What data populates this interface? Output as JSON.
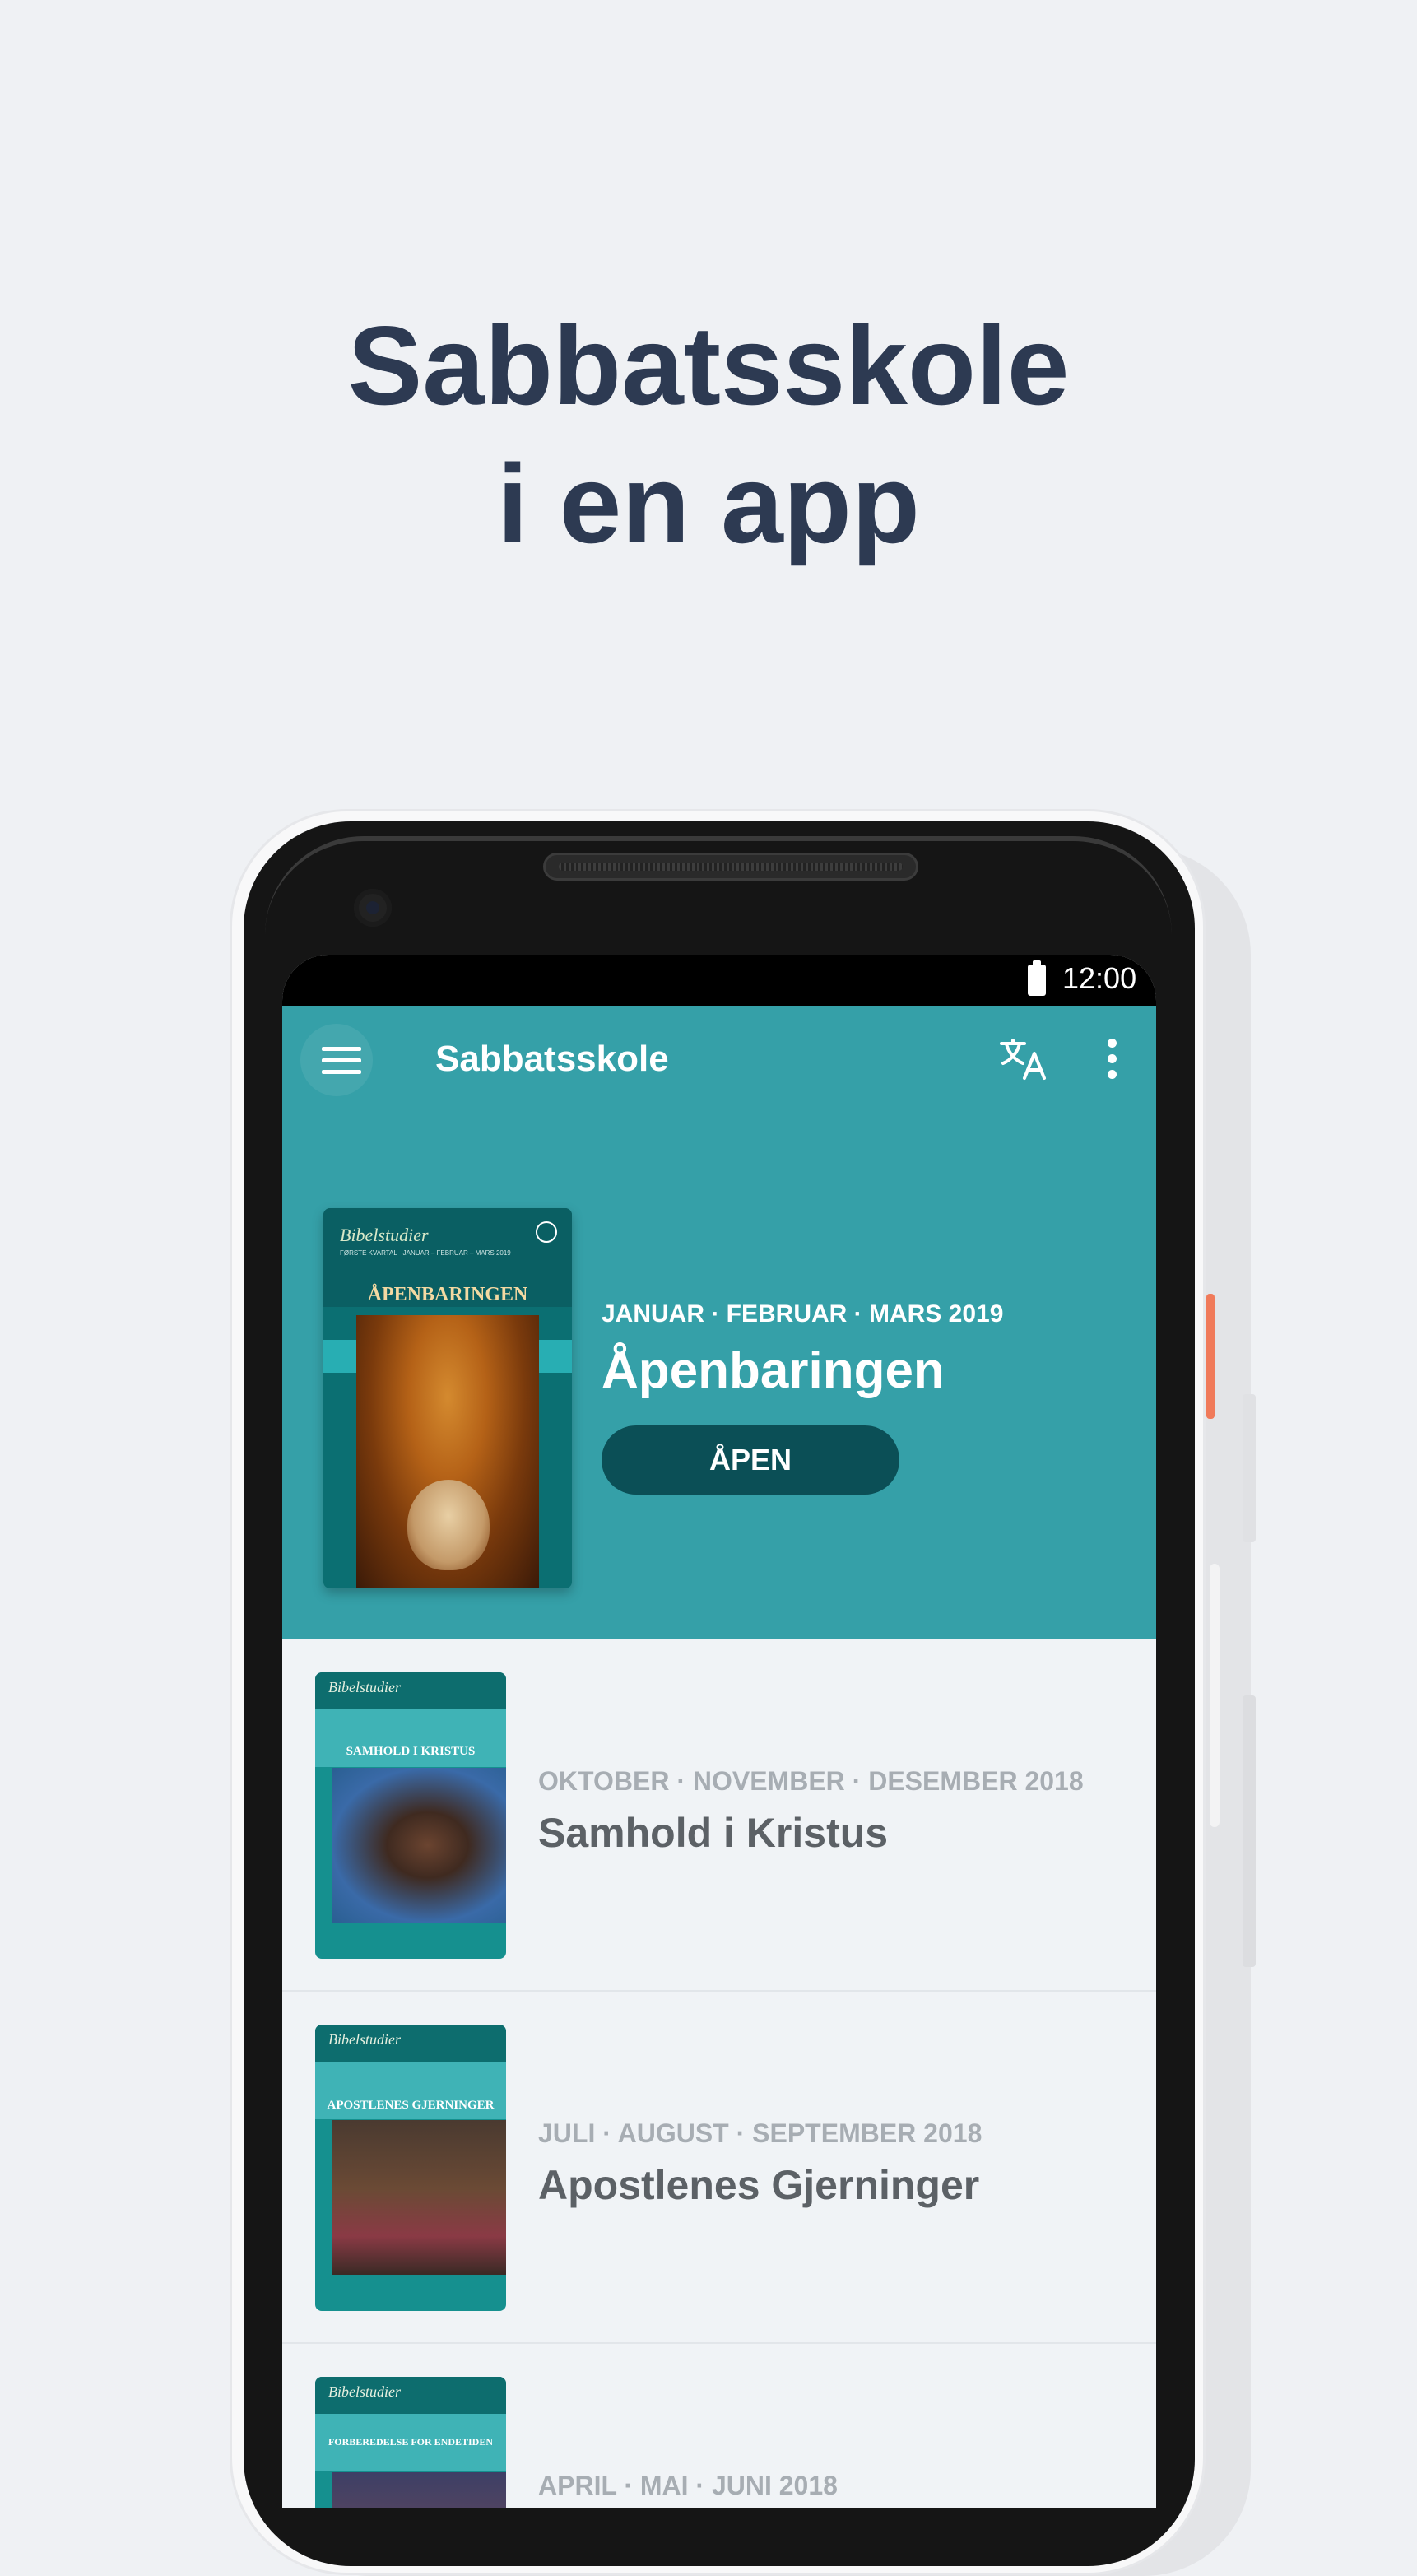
{
  "headline": {
    "line1": "Sabbatsskole",
    "line2": "i en app"
  },
  "status_bar": {
    "time": "12:00"
  },
  "app_bar": {
    "title": "Sabbatsskole",
    "menu_icon": "hamburger-menu-icon",
    "translate_icon": "translate-icon",
    "more_icon": "more-vert-icon"
  },
  "featured": {
    "cover": {
      "script": "Bibelstudier",
      "small": "FØRSTE KVARTAL · JANUAR – FEBRUAR – MARS 2019",
      "title": "ÅPENBARINGEN"
    },
    "date": "JANUAR · FEBRUAR · MARS 2019",
    "title": "Åpenbaringen",
    "button_label": "ÅPEN"
  },
  "quarterlies": [
    {
      "date": "OKTOBER · NOVEMBER · DESEMBER 2018",
      "title": "Samhold i Kristus",
      "cover_title": "SAMHOLD I KRISTUS"
    },
    {
      "date": "JULI · AUGUST · SEPTEMBER 2018",
      "title": "Apostlenes Gjerninger",
      "cover_title": "APOSTLENES GJERNINGER"
    },
    {
      "date": "APRIL · MAI · JUNI 2018",
      "title": "",
      "cover_title": "FORBEREDELSE FOR ENDETIDEN"
    }
  ],
  "colors": {
    "accent": "#35a0a8",
    "button": "#0b4f56",
    "headline": "#2d3a52"
  }
}
